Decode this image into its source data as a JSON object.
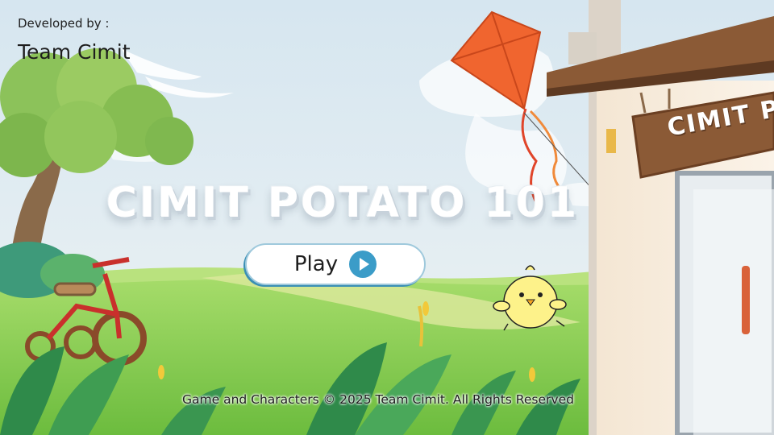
{
  "credits": {
    "label": "Developed by :",
    "team": "Team Cimit"
  },
  "game": {
    "title": "CIMIT POTATO 101"
  },
  "play_button": {
    "label": "Play",
    "icon": "play-icon"
  },
  "shop_sign": {
    "text": "CIMIT P"
  },
  "footer": {
    "copyright": "Game and Characters © 2025 Team Cimit. All Rights Reserved"
  },
  "colors": {
    "sky": "#dfeaf1",
    "grass": "#7fc94b",
    "kite": "#f0652f",
    "accent_blue": "#3b9cc8",
    "roof": "#8b5a36",
    "chick": "#fdf28a"
  }
}
